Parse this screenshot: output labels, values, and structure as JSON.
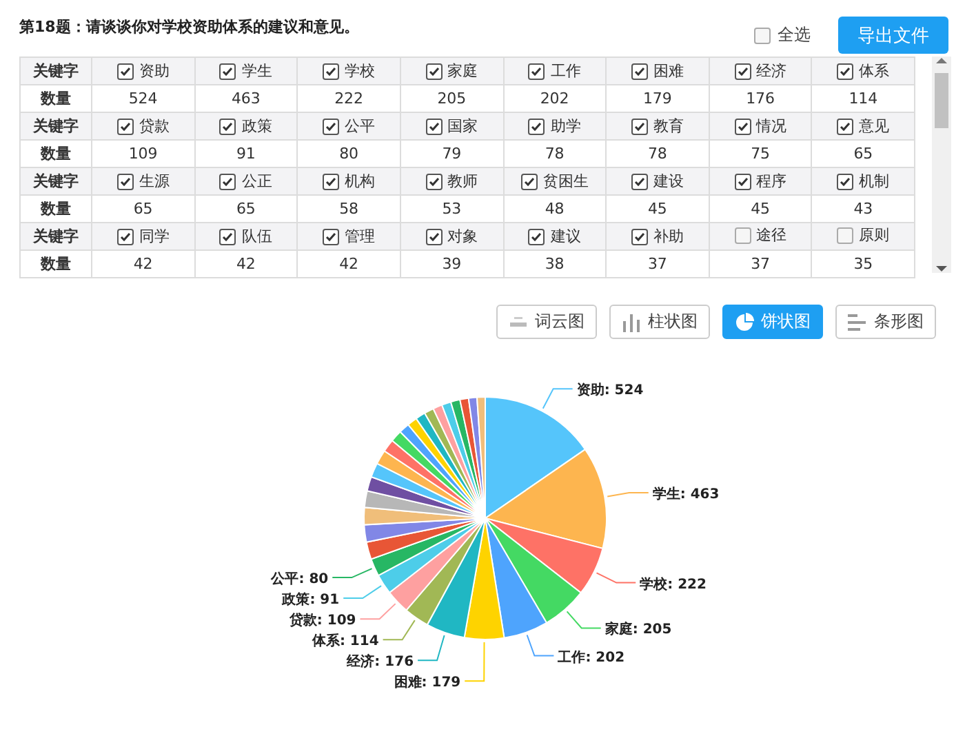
{
  "question": {
    "title": "第18题：请谈谈你对学校资助体系的建议和意见。"
  },
  "select_all": {
    "label": "全选",
    "checked": false
  },
  "export_button": {
    "label": "导出文件"
  },
  "keyword_table": {
    "blocks": [
      {
        "keyword_header": "关键字",
        "count_header": "数量",
        "items": [
          {
            "word": "资助",
            "checked": true,
            "count": "524"
          },
          {
            "word": "学生",
            "checked": true,
            "count": "463"
          },
          {
            "word": "学校",
            "checked": true,
            "count": "222"
          },
          {
            "word": "家庭",
            "checked": true,
            "count": "205"
          },
          {
            "word": "工作",
            "checked": true,
            "count": "202"
          },
          {
            "word": "困难",
            "checked": true,
            "count": "179"
          },
          {
            "word": "经济",
            "checked": true,
            "count": "176"
          },
          {
            "word": "体系",
            "checked": true,
            "count": "114"
          }
        ]
      },
      {
        "keyword_header": "关键字",
        "count_header": "数量",
        "items": [
          {
            "word": "贷款",
            "checked": true,
            "count": "109"
          },
          {
            "word": "政策",
            "checked": true,
            "count": "91"
          },
          {
            "word": "公平",
            "checked": true,
            "count": "80"
          },
          {
            "word": "国家",
            "checked": true,
            "count": "79"
          },
          {
            "word": "助学",
            "checked": true,
            "count": "78"
          },
          {
            "word": "教育",
            "checked": true,
            "count": "78"
          },
          {
            "word": "情况",
            "checked": true,
            "count": "75"
          },
          {
            "word": "意见",
            "checked": true,
            "count": "65"
          }
        ]
      },
      {
        "keyword_header": "关键字",
        "count_header": "数量",
        "items": [
          {
            "word": "生源",
            "checked": true,
            "count": "65"
          },
          {
            "word": "公正",
            "checked": true,
            "count": "65"
          },
          {
            "word": "机构",
            "checked": true,
            "count": "58"
          },
          {
            "word": "教师",
            "checked": true,
            "count": "53"
          },
          {
            "word": "贫困生",
            "checked": true,
            "count": "48"
          },
          {
            "word": "建设",
            "checked": true,
            "count": "45"
          },
          {
            "word": "程序",
            "checked": true,
            "count": "45"
          },
          {
            "word": "机制",
            "checked": true,
            "count": "43"
          }
        ]
      },
      {
        "keyword_header": "关键字",
        "count_header": "数量",
        "items": [
          {
            "word": "同学",
            "checked": true,
            "count": "42"
          },
          {
            "word": "队伍",
            "checked": true,
            "count": "42"
          },
          {
            "word": "管理",
            "checked": true,
            "count": "42"
          },
          {
            "word": "对象",
            "checked": true,
            "count": "39"
          },
          {
            "word": "建议",
            "checked": true,
            "count": "38"
          },
          {
            "word": "补助",
            "checked": true,
            "count": "37"
          },
          {
            "word": "途径",
            "checked": false,
            "count": "37"
          },
          {
            "word": "原则",
            "checked": false,
            "count": "35"
          }
        ]
      }
    ]
  },
  "chart_tabs": [
    {
      "kind": "wordcloud",
      "label": "词云图",
      "selected": false
    },
    {
      "kind": "column",
      "label": "柱状图",
      "selected": false
    },
    {
      "kind": "pie",
      "label": "饼状图",
      "selected": true
    },
    {
      "kind": "bar",
      "label": "条形图",
      "selected": false
    }
  ],
  "chart": {
    "chart_data": {
      "type": "pie",
      "annotations": [
        "资助: 524",
        "学生: 463",
        "学校: 222",
        "家庭: 205",
        "工作: 202",
        "困难: 179",
        "经济: 176",
        "体系: 114",
        "贷款: 109",
        "政策: 91",
        "公平: 80"
      ]
    }
  }
}
